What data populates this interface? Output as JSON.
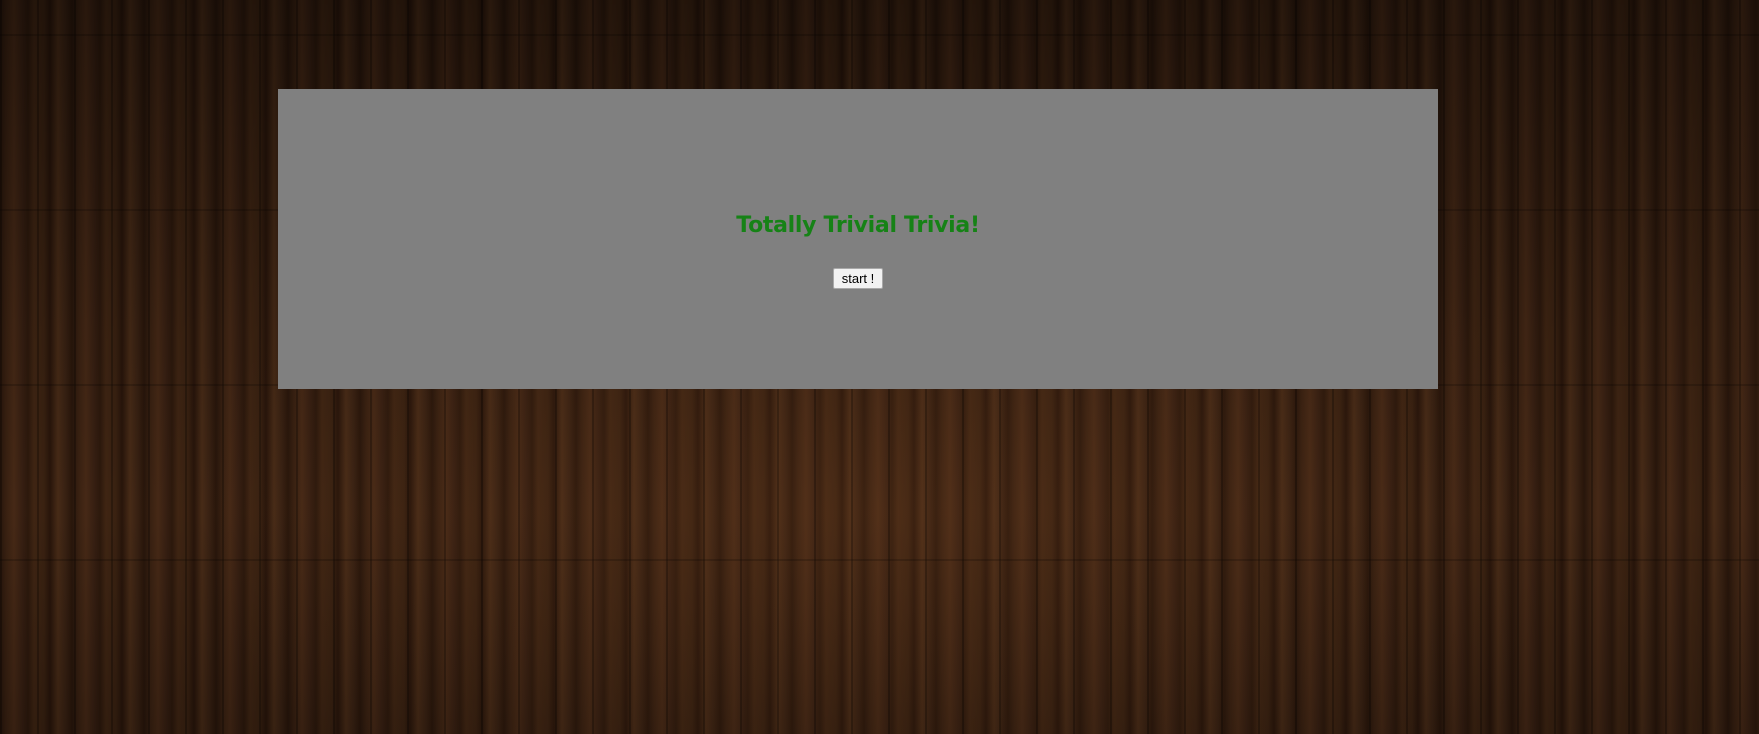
{
  "page": {
    "background_texture": "dark-wood-floor"
  },
  "game": {
    "title": "Totally Trivial Trivia!",
    "start_label": "start !",
    "title_color": "#168216",
    "panel_color": "#808080"
  }
}
